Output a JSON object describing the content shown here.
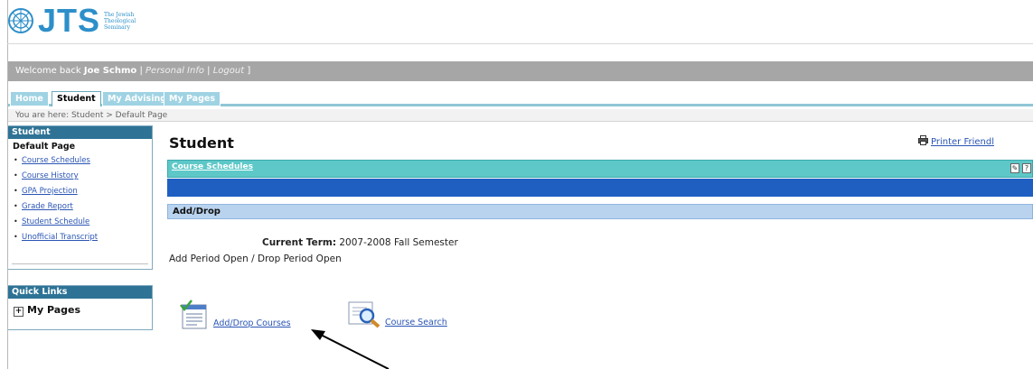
{
  "header": {
    "logo_text": "JTS",
    "logo_sub": "The Jewish Theological Seminary"
  },
  "welcome": {
    "prefix": "Welcome back ",
    "user": "Joe Schmo",
    "personal_info": "Personal Info",
    "logout": "Logout"
  },
  "tabs": [
    {
      "label": "Home",
      "active": false
    },
    {
      "label": "Student",
      "active": true
    },
    {
      "label": "My Advising",
      "active": false
    },
    {
      "label": "My Pages",
      "active": false
    }
  ],
  "breadcrumb": "You are here:  Student > Default Page",
  "sidebar": {
    "title": "Student",
    "subtitle": "Default Page",
    "items": [
      {
        "label": "Course Schedules"
      },
      {
        "label": "Course History"
      },
      {
        "label": "GPA Projection"
      },
      {
        "label": "Grade Report"
      },
      {
        "label": "Student Schedule"
      },
      {
        "label": "Unofficial Transcript"
      }
    ]
  },
  "quick_links": {
    "title": "Quick Links",
    "item": "My Pages",
    "expander": "+"
  },
  "main": {
    "title": "Student",
    "printer_friendly": "Printer Friendl",
    "portlet_title": "Course Schedules",
    "section_title": "Add/Drop",
    "current_term_label": "Current Term:",
    "current_term_value": " 2007-2008 Fall Semester",
    "period_status": "Add Period Open / Drop Period Open",
    "add_drop_link": "Add/Drop Courses",
    "course_search_link": "Course Search"
  },
  "colors": {
    "brand_blue": "#2d8fc9",
    "portlet_teal": "#5ec8c8",
    "band_blue": "#1f5fc2",
    "section_header": "#b9d3ef",
    "sidebar_header": "#2e7396",
    "link": "#2a55b4"
  },
  "icons": [
    "logo-icon",
    "printer-icon",
    "edit-icon",
    "help-icon",
    "add-drop-courses-icon",
    "magnifier-icon",
    "arrow-annotation"
  ]
}
